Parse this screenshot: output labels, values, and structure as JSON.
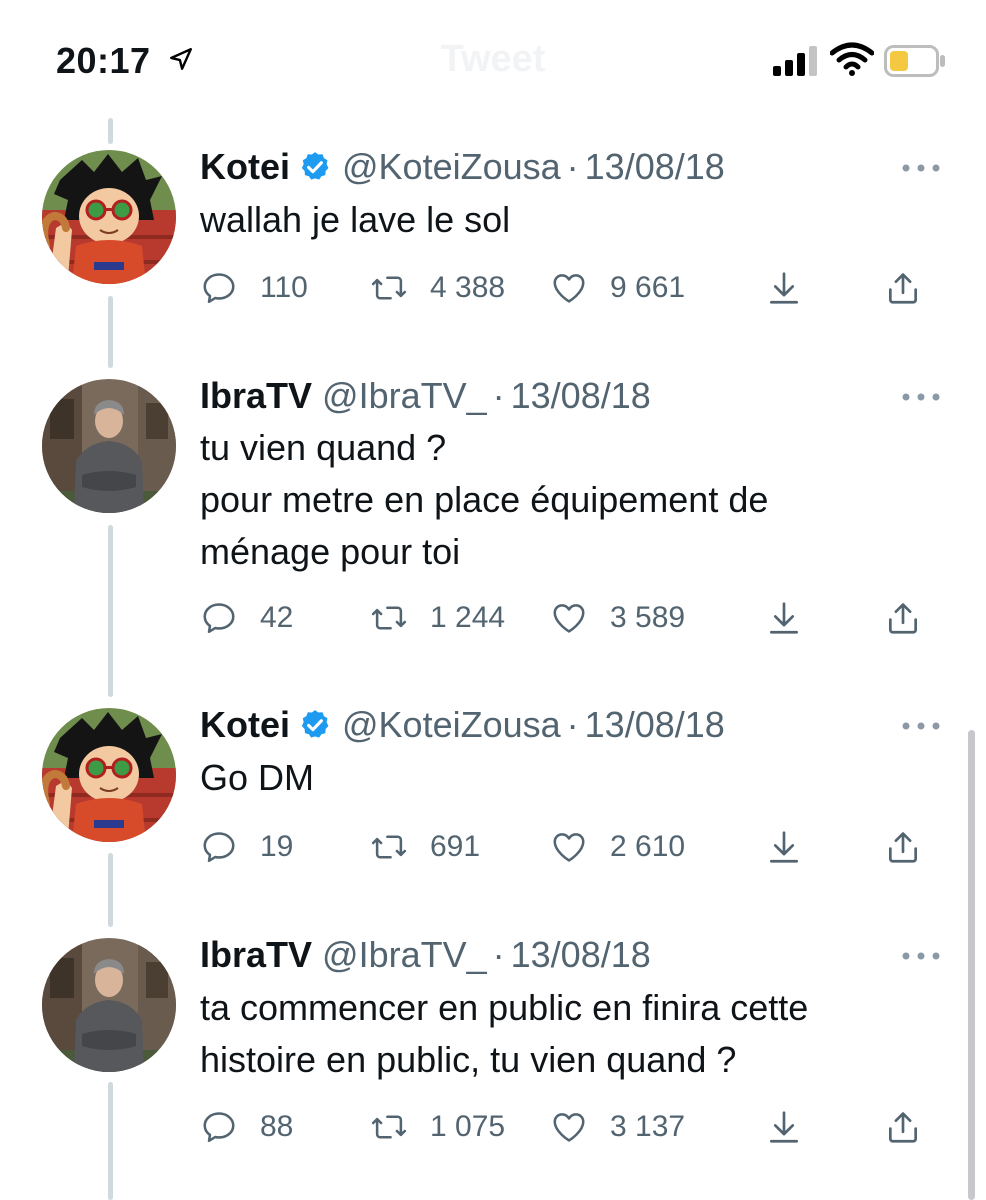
{
  "status_bar": {
    "time": "20:17",
    "ghost_title": "Tweet",
    "icons": [
      "location-arrow-icon",
      "cellular-signal-icon",
      "wifi-icon",
      "battery-low-icon"
    ],
    "battery_color": "#f5c842"
  },
  "colors": {
    "verified": "#1d9bf0",
    "secondary_text": "#536471",
    "thread_line": "#cfd9de"
  },
  "tweets": [
    {
      "name": "Kotei",
      "verified": true,
      "handle": "@KoteiZousa",
      "separator": "·",
      "date": "13/08/18",
      "text": "wallah je lave le sol",
      "replies": "110",
      "retweets": "4 388",
      "likes": "9 661"
    },
    {
      "name": "IbraTV",
      "verified": false,
      "handle": "@IbraTV_",
      "separator": "·",
      "date": "13/08/18",
      "text": "tu vien quand ?\npour metre en place équipement de ménage pour toi",
      "replies": "42",
      "retweets": "1 244",
      "likes": "3 589"
    },
    {
      "name": "Kotei",
      "verified": true,
      "handle": "@KoteiZousa",
      "separator": "·",
      "date": "13/08/18",
      "text": "Go DM",
      "replies": "19",
      "retweets": "691",
      "likes": "2 610"
    },
    {
      "name": "IbraTV",
      "verified": false,
      "handle": "@IbraTV_",
      "separator": "·",
      "date": "13/08/18",
      "text": "ta commencer en public en finira cette histoire en public, tu vien quand ?",
      "replies": "88",
      "retweets": "1 075",
      "likes": "3 137"
    }
  ]
}
